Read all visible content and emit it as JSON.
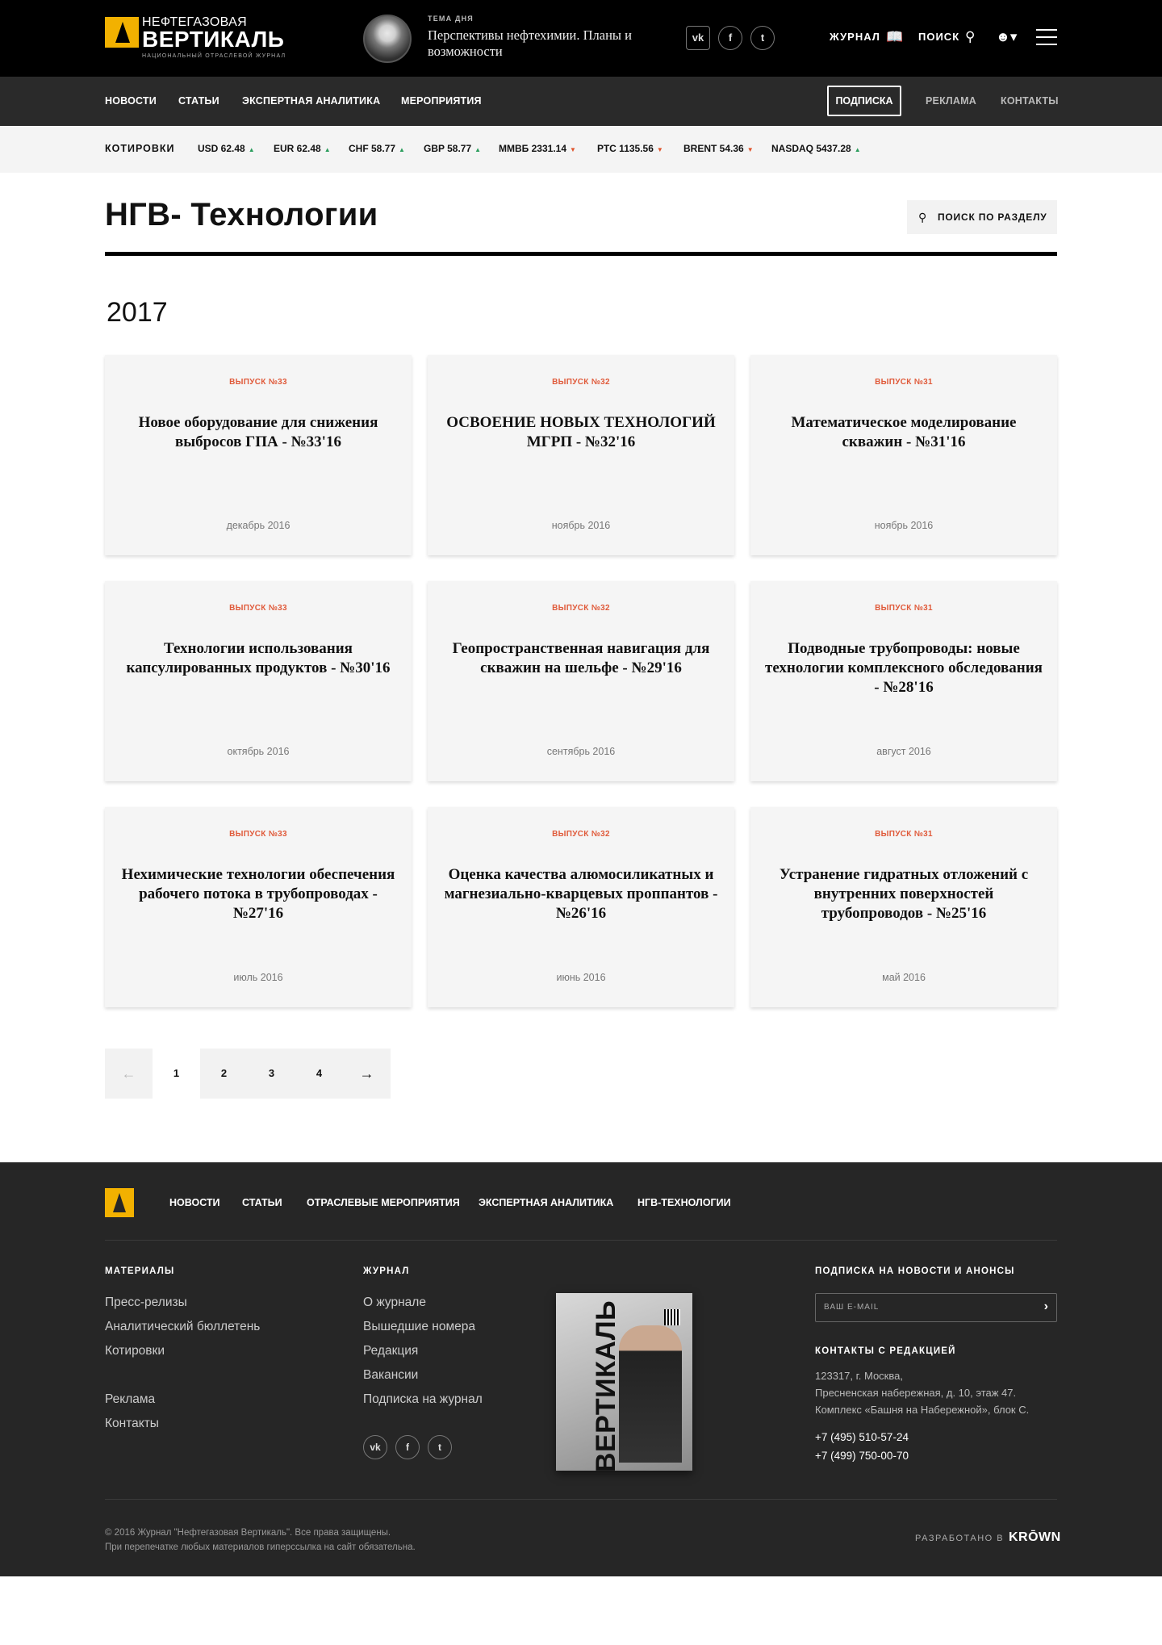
{
  "header": {
    "logo_line1": "НЕФТЕГАЗОВАЯ",
    "logo_line2": "ВЕРТИКАЛЬ",
    "logo_tagline": "НАЦИОНАЛЬНЫЙ ОТРАСЛЕВОЙ ЖУРНАЛ",
    "topic_label": "ТЕМА ДНЯ",
    "topic_text": "Перспективы нефтехимии. Планы и возможности",
    "social": {
      "vk": "vk",
      "fb": "f",
      "tw": "t"
    },
    "journal_label": "ЖУРНАЛ",
    "search_label": "ПОИСК"
  },
  "nav": {
    "items": [
      "НОВОСТИ",
      "СТАТЬИ",
      "ЭКСПЕРТНАЯ АНАЛИТИКА",
      "МЕРОПРИЯТИЯ"
    ],
    "subscribe": "ПОДПИСКА",
    "right": [
      "РЕКЛАМА",
      "КОНТАКТЫ"
    ]
  },
  "quotes": {
    "label": "КОТИРОВКИ",
    "items": [
      {
        "text": "USD 62.48",
        "dir": "▲"
      },
      {
        "text": "EUR 62.48",
        "dir": "▲"
      },
      {
        "text": "CHF 58.77",
        "dir": "▲"
      },
      {
        "text": "GBP 58.77",
        "dir": "▲"
      },
      {
        "text": "ММВБ 2331.14",
        "dir": "▼"
      },
      {
        "text": "РТС 1135.56",
        "dir": "▼"
      },
      {
        "text": "BRENT 54.36",
        "dir": "▼"
      },
      {
        "text": "NASDAQ 5437.28",
        "dir": "▲"
      }
    ],
    "colors": {
      "up": "#2a9d5c",
      "down": "#e0542b"
    }
  },
  "page": {
    "title": "НГВ- Технологии",
    "section_search": "ПОИСК ПО РАЗДЕЛУ",
    "year": "2017"
  },
  "cards": [
    {
      "issue": "ВЫПУСК №33",
      "title": "Новое оборудование для снижения выбросов ГПА - №33'16",
      "date": "декабрь 2016"
    },
    {
      "issue": "ВЫПУСК №32",
      "title": "ОСВОЕНИЕ НОВЫХ ТЕХНОЛОГИЙ МГРП - №32'16",
      "date": "ноябрь 2016"
    },
    {
      "issue": "ВЫПУСК №31",
      "title": "Математическое моделирование скважин - №31'16",
      "date": "ноябрь 2016"
    },
    {
      "issue": "ВЫПУСК №33",
      "title": "Технологии использования капсулированных продуктов - №30'16",
      "date": "октябрь 2016"
    },
    {
      "issue": "ВЫПУСК №32",
      "title": "Геопространственная навигация для скважин на шельфе - №29'16",
      "date": "сентябрь 2016"
    },
    {
      "issue": "ВЫПУСК №31",
      "title": "Подводные трубопроводы: новые технологии комплексного обследования - №28'16",
      "date": "август 2016"
    },
    {
      "issue": "ВЫПУСК №33",
      "title": "Нехимические технологии обеспечения рабочего потока в трубопроводах - №27'16",
      "date": "июль 2016"
    },
    {
      "issue": "ВЫПУСК №32",
      "title": "Оценка качества алюмосиликатных и магнезиально-кварцевых проппантов - №26'16",
      "date": "июнь 2016"
    },
    {
      "issue": "ВЫПУСК №31",
      "title": "Устранение гидратных отложений с внутренних поверхностей трубопроводов - №25'16",
      "date": "май 2016"
    }
  ],
  "pagination": {
    "prev": "←",
    "pages": [
      "1",
      "2",
      "3",
      "4"
    ],
    "next": "→",
    "current": "1"
  },
  "footer": {
    "nav": [
      "НОВОСТИ",
      "СТАТЬИ",
      "ОТРАСЛЕВЫЕ МЕРОПРИЯТИЯ",
      "ЭКСПЕРТНАЯ АНАЛИТИКА",
      "НГВ-ТЕХНОЛОГИИ"
    ],
    "materials_head": "МАТЕРИАЛЫ",
    "materials": [
      "Пресс-релизы",
      "Аналитический бюллетень",
      "Котировки",
      "Реклама",
      "Контакты"
    ],
    "journal_head": "ЖУРНАЛ",
    "journal": [
      "О журнале",
      "Вышедшие номера",
      "Редакция",
      "Вакансии",
      "Подписка на журнал"
    ],
    "cover_title": "ВЕРТИКАЛЬ",
    "subscribe_head": "ПОДПИСКА НА НОВОСТИ И АНОНСЫ",
    "email_placeholder": "ВАШ E-MAIL",
    "contacts_head": "КОНТАКТЫ С РЕДАКЦИЕЙ",
    "address": [
      "123317, г. Москва,",
      "Пресненская набережная, д. 10, этаж 47.",
      "Комплекс «Башня на Набережной», блок С."
    ],
    "phones": [
      "+7 (495) 510-57-24",
      "+7 (499) 750-00-70"
    ],
    "copyright": [
      "© 2016 Журнал \"Нефтегазовая Вертикаль\". Все права защищены.",
      "При перепечатке любых материалов гиперссылка на сайт обязательна."
    ],
    "dev_label": "РАЗРАБОТАНО В",
    "dev_brand": "KRŌWN"
  }
}
